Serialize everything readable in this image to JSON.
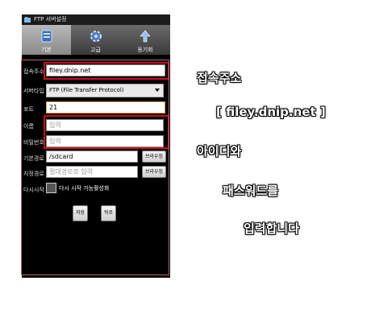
{
  "statusbar": {
    "title": "FTP 서버설정"
  },
  "tabs": [
    {
      "label": "기본",
      "icon": "server-icon",
      "active": true
    },
    {
      "label": "고급",
      "icon": "gear-icon",
      "active": false
    },
    {
      "label": "동기화",
      "icon": "upload-arrow-icon",
      "active": false
    }
  ],
  "form": {
    "host": {
      "label": "접속주소",
      "value": "filey.dnip.net"
    },
    "server_type": {
      "label": "서버타입",
      "value": "FTP (File Transfer Protocol)"
    },
    "port": {
      "label": "포트",
      "value": "21"
    },
    "name": {
      "label": "이름",
      "placeholder": "입력"
    },
    "password": {
      "label": "비밀번호",
      "placeholder": "입력"
    },
    "base_path": {
      "label": "기본경로",
      "value": "/sdcard",
      "browse_label": "브라우징"
    },
    "dest_path": {
      "label": "지정경로",
      "placeholder": "절대경로로 입력",
      "browse_label": "브라우징"
    },
    "restart": {
      "label": "다시시작",
      "checkbox_label": "다시 시작 가능활성화"
    }
  },
  "buttons": {
    "save": "저장",
    "back": "뒤로"
  },
  "annotations": {
    "line1": "접속주소",
    "line2": "[ filey.dnip.net ]",
    "line3": "아이디와",
    "line4": "패스워드를",
    "line5": "입력합니다"
  },
  "colors": {
    "highlight": "#d10d1e",
    "background": "#000000"
  }
}
